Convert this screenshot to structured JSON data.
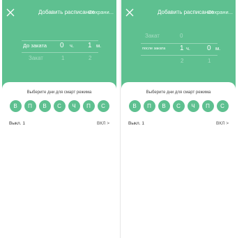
{
  "colors": {
    "accent": "#5ec090",
    "sheet": "#ffffff"
  },
  "icons": {
    "close": "close-icon",
    "chevron": "chevron-right-icon"
  },
  "panels": [
    {
      "header": {
        "title": "Добавить расписание",
        "save_label": "Сохрани..."
      },
      "picker": {
        "row_selected": {
          "event": "До заката",
          "hours": "0",
          "hours_unit": "ч.",
          "minutes": "1",
          "minutes_unit": "м."
        },
        "row_below": {
          "event": "Закат",
          "hours": "1",
          "minutes": "2"
        },
        "row_below2": {
          "hours": "",
          "minutes": ""
        }
      },
      "sheet": {
        "prompt": "Выберите дни для смарт режима",
        "days": [
          "В",
          "П",
          "В",
          "С",
          "Ч",
          "П",
          "С"
        ],
        "off_label": "Выкл. 1",
        "off_value": "ВКЛ >"
      }
    },
    {
      "header": {
        "title": "Добавить расписание",
        "save_label": "Сохрани..."
      },
      "picker": {
        "row_above": {
          "event": "Закат",
          "hours": "0",
          "minutes": ""
        },
        "row_selected": {
          "event": "после заката",
          "hours": "1",
          "hours_unit": "ч.",
          "minutes": "0",
          "minutes_unit": "м."
        },
        "row_below": {
          "hours": "2",
          "minutes": "1"
        }
      },
      "sheet": {
        "prompt": "Выберите дни для смарт режима",
        "days": [
          "В",
          "П",
          "В",
          "С",
          "Ч",
          "П",
          "С"
        ],
        "off_label": "Выкл. 1",
        "off_value": "ВКЛ >"
      }
    }
  ]
}
